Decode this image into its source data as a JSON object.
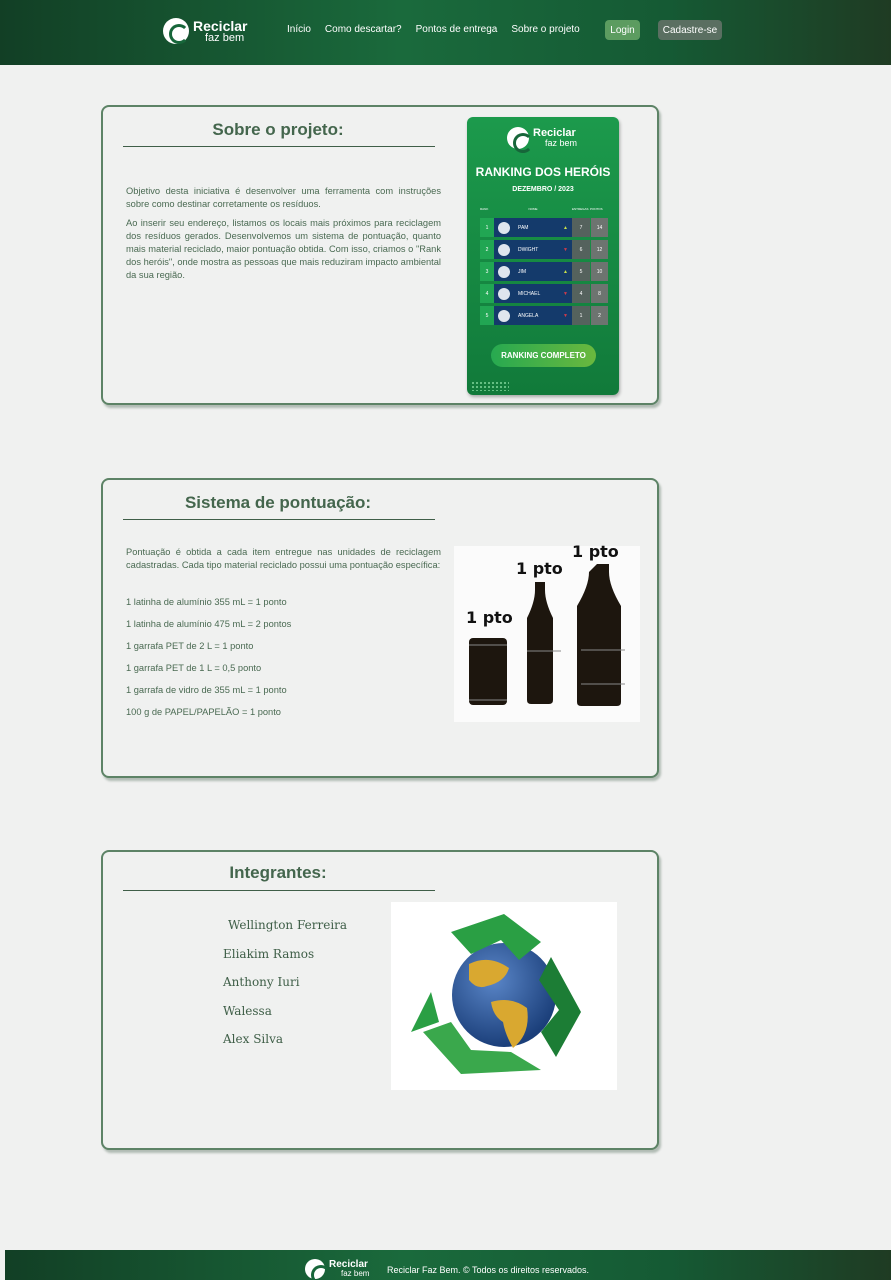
{
  "header": {
    "logo_line1": "Reciclar",
    "logo_line2": "faz bem",
    "nav": [
      "Início",
      "Como descartar?",
      "Pontos de entrega",
      "Sobre o projeto"
    ],
    "login_label": "Login",
    "signup_label": "Cadastre-se"
  },
  "about": {
    "title": "Sobre o projeto:",
    "paragraphs": [
      "Objetivo desta iniciativa é desenvolver uma ferramenta com instruções sobre como destinar corretamente os resíduos.",
      "Ao inserir seu endereço, listamos os locais mais próximos para reciclagem dos resíduos gerados. Desenvolvemos um sistema de pontuação, quanto mais material reciclado, maior pontuação obtida. Com isso, criamos o \"Rank dos heróis\", onde mostra as pessoas que mais reduziram impacto ambiental da sua região."
    ]
  },
  "ranking": {
    "logo_line1": "Reciclar",
    "logo_line2": "faz bem",
    "title": "RANKING DOS HERÓIS",
    "subtitle": "DEZEMBRO / 2023",
    "headers": [
      "RANK",
      "NOME",
      "ENTREGAS",
      "PONTOS"
    ],
    "rows": [
      {
        "rank": "1",
        "name": "PAM",
        "trend": "▲",
        "trend_color": "#c8e04a",
        "c1": "7",
        "c2": "14"
      },
      {
        "rank": "2",
        "name": "DWIGHT",
        "trend": "▼",
        "trend_color": "#d23a4a",
        "c1": "6",
        "c2": "12"
      },
      {
        "rank": "3",
        "name": "JIM",
        "trend": "▲",
        "trend_color": "#c8e04a",
        "c1": "5",
        "c2": "10"
      },
      {
        "rank": "4",
        "name": "MICHAEL",
        "trend": "▼",
        "trend_color": "#d23a4a",
        "c1": "4",
        "c2": "8"
      },
      {
        "rank": "5",
        "name": "ANGELA",
        "trend": "▼",
        "trend_color": "#d23a4a",
        "c1": "1",
        "c2": "2"
      }
    ],
    "button_label": "RANKING COMPLETO"
  },
  "points": {
    "title": "Sistema de pontuação:",
    "intro": "Pontuação é obtida a cada item entregue nas unidades de reciclagem cadastradas. Cada tipo material reciclado possui uma pontuação específica:",
    "items": [
      "1 latinha de alumínio 355 mL = 1 ponto",
      "1 latinha de alumínio 475 mL = 2 pontos",
      "1 garrafa PET de 2 L = 1 ponto",
      "1 garrafa PET de 1 L = 0,5 ponto",
      "1 garrafa de vidro de 355 mL = 1 ponto",
      "100 g de PAPEL/PAPELÃO = 1 ponto"
    ],
    "image_labels": [
      "1 pto",
      "1 pto",
      "1 pto"
    ]
  },
  "members": {
    "title": "Integrantes:",
    "names": [
      "Wellington Ferreira",
      "Eliakim Ramos",
      "Anthony Iuri",
      "Walessa",
      "Alex Silva"
    ]
  },
  "footer": {
    "logo_line1": "Reciclar",
    "logo_line2": "faz bem",
    "text": "Reciclar Faz Bem. © Todos os direitos reservados."
  }
}
